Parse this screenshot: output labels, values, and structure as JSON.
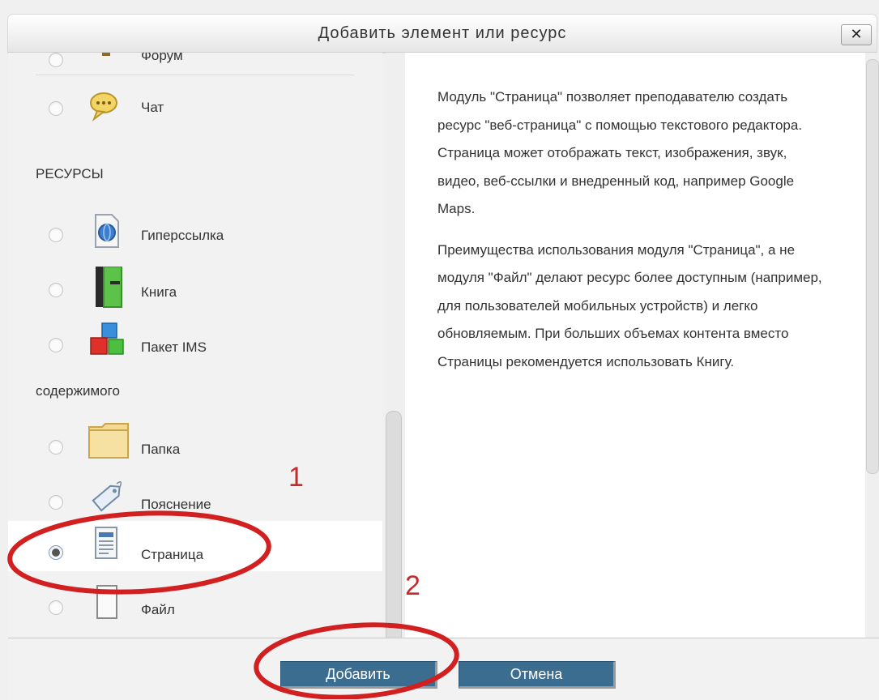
{
  "dialog": {
    "title": "Добавить элемент или ресурс",
    "close_label": "✕"
  },
  "list": {
    "items": [
      {
        "label": "Форум",
        "icon": "forum-icon"
      },
      {
        "label": "Чат",
        "icon": "chat-icon"
      }
    ],
    "section_resources": "РЕСУРСЫ",
    "resources": [
      {
        "label": "Гиперссылка",
        "icon": "hyperlink-icon"
      },
      {
        "label": "Книга",
        "icon": "book-icon"
      },
      {
        "label": "Пакет IMS",
        "icon": "ims-package-icon"
      }
    ],
    "continuation": "содержимого",
    "resources2": [
      {
        "label": "Папка",
        "icon": "folder-icon"
      },
      {
        "label": "Пояснение",
        "icon": "label-tag-icon"
      },
      {
        "label": "Страница",
        "icon": "page-icon",
        "selected": true
      },
      {
        "label": "Файл",
        "icon": "file-icon"
      }
    ]
  },
  "description": {
    "p1": "Модуль \"Страница\" позволяет преподавателю создать ресурс \"веб-страница\" с помощью текстового редактора. Страница может отображать текст, изображения, звук, видео, веб-ссылки и внедренный код, например Google Maps.",
    "p2": "Преимущества использования модуля \"Страница\", а не модуля \"Файл\" делают ресурс более доступным (например, для пользователей мобильных устройств) и легко обновляемым. При больших объемах контента вместо Страницы рекомендуется использовать Книгу."
  },
  "buttons": {
    "add": "Добавить",
    "cancel": "Отмена"
  },
  "annotations": {
    "one": "1",
    "two": "2"
  },
  "colors": {
    "button": "#3a6d90",
    "annotation": "#c62b2b"
  }
}
